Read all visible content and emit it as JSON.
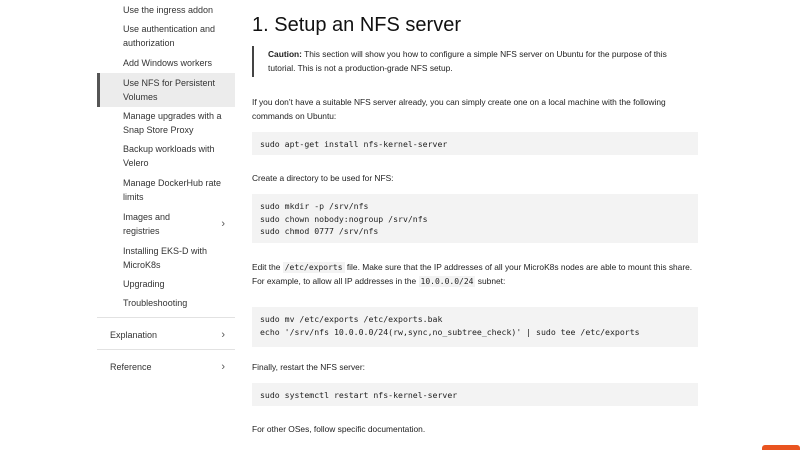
{
  "sidebar": {
    "items": [
      {
        "label": "Use the ingress addon"
      },
      {
        "label": "Use authentication and authorization"
      },
      {
        "label": "Add Windows workers"
      },
      {
        "label": "Use NFS for Persistent Volumes",
        "active": true
      },
      {
        "label": "Manage upgrades with a Snap Store Proxy"
      },
      {
        "label": "Backup workloads with Velero"
      },
      {
        "label": "Manage DockerHub rate limits"
      },
      {
        "label": "Images and registries",
        "expandable": true
      },
      {
        "label": "Installing EKS-D with MicroK8s"
      },
      {
        "label": "Upgrading"
      },
      {
        "label": "Troubleshooting"
      }
    ],
    "sections": [
      {
        "label": "Explanation"
      },
      {
        "label": "Reference"
      }
    ]
  },
  "main": {
    "title": "1. Setup an NFS server",
    "caution_label": "Caution:",
    "caution_text": " This section will show you how to configure a simple NFS server on Ubuntu for the purpose of this tutorial. This is not a production-grade NFS setup.",
    "p1": "If you don’t have a suitable NFS server already, you can simply create one on a local machine with the following commands on Ubuntu:",
    "code1": "sudo apt-get install nfs-kernel-server",
    "p2": "Create a directory to be used for NFS:",
    "code2": "sudo mkdir -p /srv/nfs\nsudo chown nobody:nogroup /srv/nfs\nsudo chmod 0777 /srv/nfs",
    "p3_a": "Edit the ",
    "p3_code1": "/etc/exports",
    "p3_b": " file. Make sure that the IP addresses of all your MicroK8s nodes are able to mount this share. For example, to allow all IP addresses in the ",
    "p3_code2": "10.0.0.0/24",
    "p3_c": " subnet:",
    "code3": "sudo mv /etc/exports /etc/exports.bak\necho '/srv/nfs 10.0.0.0/24(rw,sync,no_subtree_check)' | sudo tee /etc/exports",
    "p4": "Finally, restart the NFS server:",
    "code4": "sudo systemctl restart nfs-kernel-server",
    "p5": "For other OSes, follow specific documentation."
  },
  "icons": {
    "chevron": "chevron-right-icon"
  },
  "colors": {
    "active_border": "#555555",
    "active_bg": "#ececec",
    "code_bg": "#f3f3f3",
    "accent": "#e95420"
  }
}
